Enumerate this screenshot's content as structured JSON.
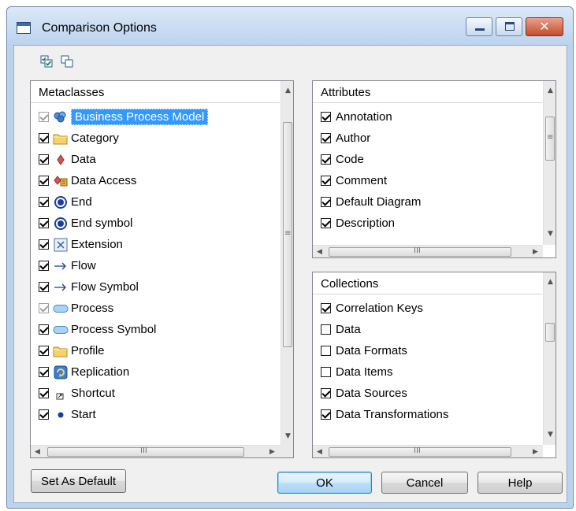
{
  "window": {
    "title": "Comparison Options"
  },
  "toolbar": {
    "icons": [
      "select-all-icon",
      "deselect-all-icon"
    ]
  },
  "metaclasses": {
    "header": "Metaclasses",
    "items": [
      {
        "label": "Business Process Model",
        "checked": true,
        "disabled": true,
        "selected": true,
        "icon": "business-process-model-icon"
      },
      {
        "label": "Category",
        "checked": true,
        "icon": "folder-icon"
      },
      {
        "label": "Data",
        "checked": true,
        "icon": "data-icon"
      },
      {
        "label": "Data Access",
        "checked": true,
        "icon": "data-access-icon"
      },
      {
        "label": "End",
        "checked": true,
        "icon": "end-icon"
      },
      {
        "label": "End symbol",
        "checked": true,
        "icon": "end-icon"
      },
      {
        "label": "Extension",
        "checked": true,
        "icon": "extension-icon"
      },
      {
        "label": "Flow",
        "checked": true,
        "icon": "flow-arrow-icon"
      },
      {
        "label": "Flow Symbol",
        "checked": true,
        "icon": "flow-arrow-icon"
      },
      {
        "label": "Process",
        "checked": true,
        "disabled": true,
        "icon": "process-icon"
      },
      {
        "label": "Process Symbol",
        "checked": true,
        "icon": "process-icon"
      },
      {
        "label": "Profile",
        "checked": true,
        "icon": "folder-icon"
      },
      {
        "label": "Replication",
        "checked": true,
        "icon": "replication-icon"
      },
      {
        "label": "Shortcut",
        "checked": true,
        "icon": "shortcut-icon"
      },
      {
        "label": "Start",
        "checked": true,
        "icon": "start-icon"
      }
    ]
  },
  "attributes": {
    "header": "Attributes",
    "items": [
      {
        "label": "Annotation",
        "checked": true
      },
      {
        "label": "Author",
        "checked": true
      },
      {
        "label": "Code",
        "checked": true
      },
      {
        "label": "Comment",
        "checked": true
      },
      {
        "label": "Default Diagram",
        "checked": true
      },
      {
        "label": "Description",
        "checked": true
      }
    ]
  },
  "collections": {
    "header": "Collections",
    "items": [
      {
        "label": "Correlation Keys",
        "checked": true
      },
      {
        "label": "Data",
        "checked": false
      },
      {
        "label": "Data Formats",
        "checked": false
      },
      {
        "label": "Data Items",
        "checked": false
      },
      {
        "label": "Data Sources",
        "checked": true
      },
      {
        "label": "Data Transformations",
        "checked": true
      }
    ]
  },
  "buttons": {
    "set_default": "Set As Default",
    "ok": "OK",
    "cancel": "Cancel",
    "help": "Help"
  },
  "scroll": {
    "grip": "≡",
    "hgrip": "III"
  },
  "colors": {
    "selection": "#3399ff",
    "titlebar": "#bcd3ee",
    "close_button": "#c44c2c"
  }
}
